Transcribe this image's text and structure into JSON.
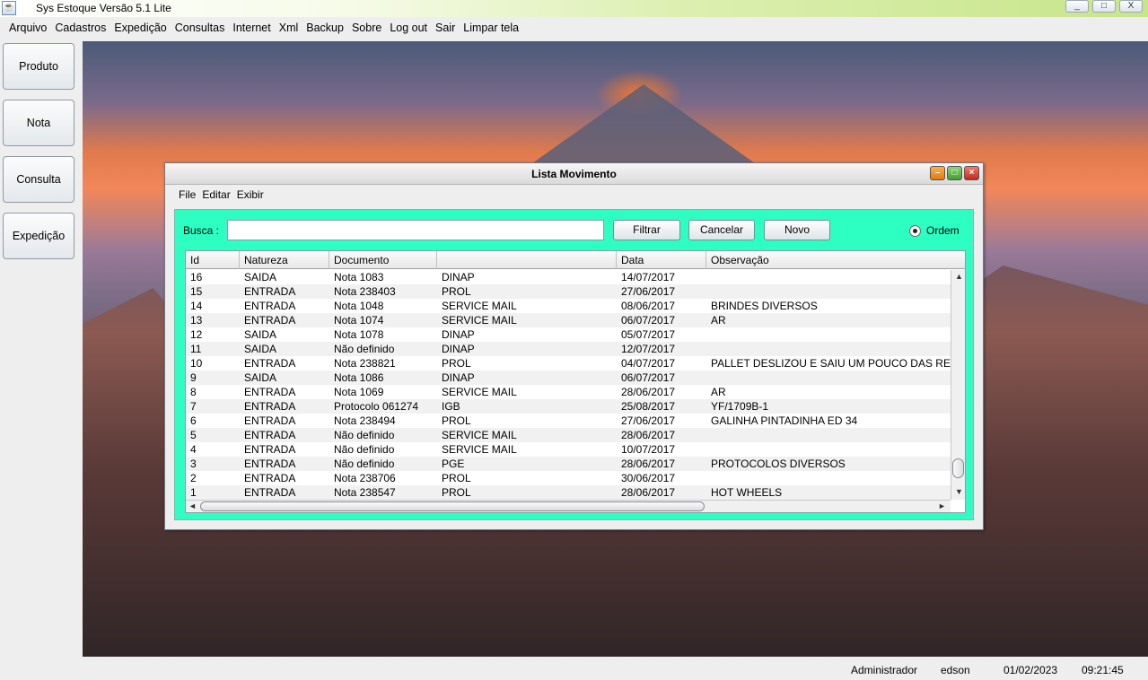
{
  "window": {
    "title": "Sys Estoque Versão 5.1  Lite",
    "controls": [
      "_",
      "□",
      "X"
    ]
  },
  "menu": [
    "Arquivo",
    "Cadastros",
    "Expedição",
    "Consultas",
    "Internet",
    "Xml",
    "Backup",
    "Sobre",
    "Log out",
    "Sair",
    "Limpar tela"
  ],
  "sidebar": [
    "Produto",
    "Nota",
    "Consulta",
    "Expedição"
  ],
  "dialog": {
    "title": "Lista Movimento",
    "menu": [
      "File",
      "Editar",
      "Exibir"
    ],
    "busca_label": "Busca :",
    "busca_value": "",
    "buttons": {
      "filtrar": "Filtrar",
      "cancelar": "Cancelar",
      "novo": "Novo"
    },
    "ordem_label": "Ordem",
    "columns": [
      "Id",
      "Natureza",
      "Documento",
      "",
      "Data",
      "Observação"
    ],
    "rows": [
      [
        "16",
        "SAIDA",
        "Nota 1083",
        "DINAP",
        "14/07/2017",
        ""
      ],
      [
        "15",
        "ENTRADA",
        "Nota 238403",
        "PROL",
        "27/06/2017",
        ""
      ],
      [
        "14",
        "ENTRADA",
        "Nota 1048",
        "SERVICE MAIL",
        "08/06/2017",
        "BRINDES DIVERSOS"
      ],
      [
        "13",
        "ENTRADA",
        "Nota 1074",
        "SERVICE MAIL",
        "06/07/2017",
        "AR"
      ],
      [
        "12",
        "SAIDA",
        "Nota 1078",
        "DINAP",
        "05/07/2017",
        ""
      ],
      [
        "11",
        "SAIDA",
        "Não definido",
        "DINAP",
        "12/07/2017",
        ""
      ],
      [
        "10",
        "ENTRADA",
        "Nota 238821",
        "PROL",
        "04/07/2017",
        "PALLET DESLIZOU E SAIU UM POUCO DAS REV"
      ],
      [
        "9",
        "SAIDA",
        "Nota 1086",
        "DINAP",
        "06/07/2017",
        ""
      ],
      [
        "8",
        "ENTRADA",
        "Nota 1069",
        "SERVICE MAIL",
        "28/06/2017",
        "AR"
      ],
      [
        "7",
        "ENTRADA",
        "Protocolo 061274",
        "IGB",
        "25/08/2017",
        "YF/1709B-1"
      ],
      [
        "6",
        "ENTRADA",
        "Nota 238494",
        "PROL",
        "27/06/2017",
        "GALINHA PINTADINHA ED 34"
      ],
      [
        "5",
        "ENTRADA",
        "Não definido",
        "SERVICE MAIL",
        "28/06/2017",
        ""
      ],
      [
        "4",
        "ENTRADA",
        "Não definido",
        "SERVICE MAIL",
        "10/07/2017",
        ""
      ],
      [
        "3",
        "ENTRADA",
        "Não definido",
        "PGE",
        "28/06/2017",
        "PROTOCOLOS DIVERSOS"
      ],
      [
        "2",
        "ENTRADA",
        "Nota 238706",
        "PROL",
        "30/06/2017",
        ""
      ],
      [
        "1",
        "ENTRADA",
        "Nota 238547",
        "PROL",
        "28/06/2017",
        "HOT WHEELS"
      ]
    ]
  },
  "status": {
    "user_role": "Administrador",
    "user": "edson",
    "date": "01/02/2023",
    "time": "09:21:45"
  }
}
